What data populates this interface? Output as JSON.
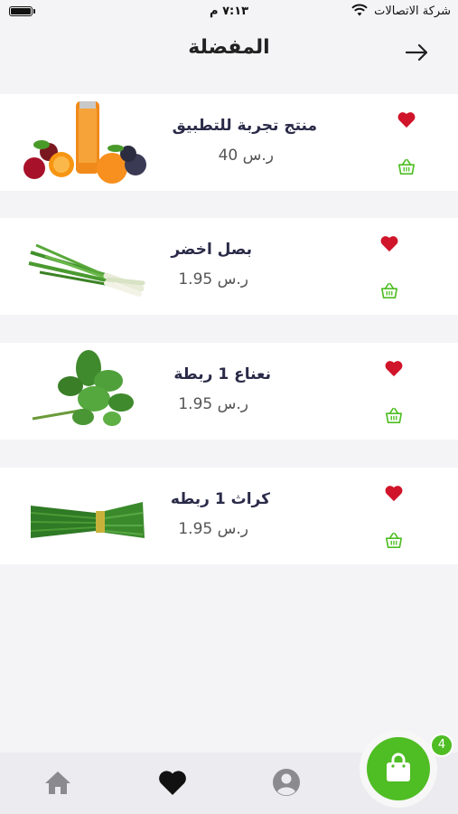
{
  "status_bar": {
    "carrier": "شركة الاتصالات",
    "time": "٧:١٣ م"
  },
  "header": {
    "title": "المفضلة"
  },
  "products": [
    {
      "name": "منتج تجربة للتطبيق",
      "price": "ر.س 40",
      "image": "fruit-drink-image"
    },
    {
      "name": "بصل اخضر",
      "price": "ر.س 1.95",
      "image": "green-onion-image"
    },
    {
      "name": "نعناع 1 ربطة",
      "price": "ر.س 1.95",
      "image": "mint-bunch-image"
    },
    {
      "name": "كراث 1 ربطه",
      "price": "ر.س 1.95",
      "image": "leek-bunch-image"
    }
  ],
  "cart": {
    "count": "4"
  },
  "colors": {
    "accent_green": "#4fbd24",
    "heart_red": "#d0142a",
    "title_navy": "#2a2a48"
  }
}
